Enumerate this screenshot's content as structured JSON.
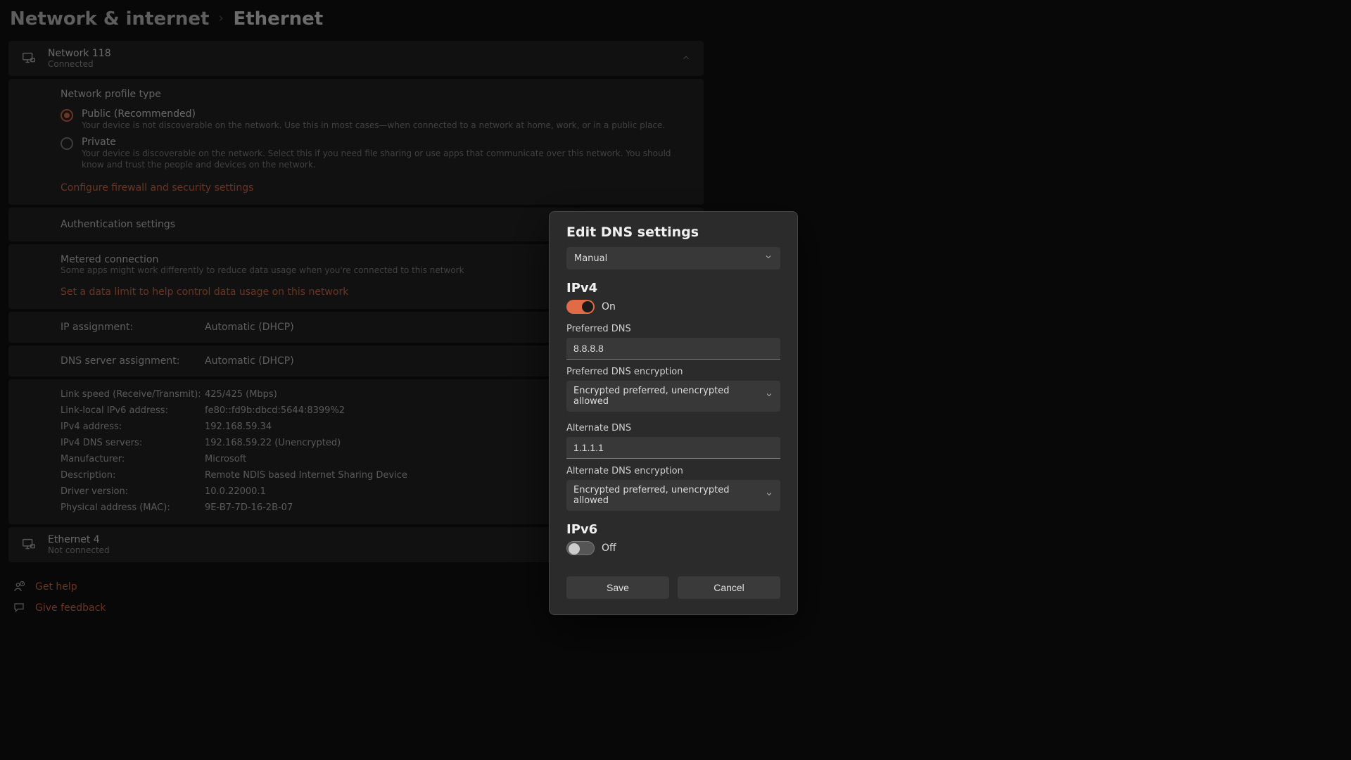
{
  "breadcrumb": {
    "parent": "Network & internet",
    "current": "Ethernet"
  },
  "adapter_primary": {
    "name": "Network 118",
    "status": "Connected"
  },
  "profile": {
    "section_title": "Network profile type",
    "options": [
      {
        "label": "Public (Recommended)",
        "desc": "Your device is not discoverable on the network. Use this in most cases—when connected to a network at home, work, or in a public place.",
        "selected": true
      },
      {
        "label": "Private",
        "desc": "Your device is discoverable on the network. Select this if you need file sharing or use apps that communicate over this network. You should know and trust the people and devices on the network.",
        "selected": false
      }
    ],
    "firewall_link": "Configure firewall and security settings"
  },
  "auth_section_title": "Authentication settings",
  "metered": {
    "title": "Metered connection",
    "desc": "Some apps might work differently to reduce data usage when you're connected to this network",
    "link": "Set a data limit to help control data usage on this network"
  },
  "assignments": {
    "ip_label": "IP assignment:",
    "ip_value": "Automatic (DHCP)",
    "dns_label": "DNS server assignment:",
    "dns_value": "Automatic (DHCP)"
  },
  "info": [
    {
      "label": "Link speed (Receive/Transmit):",
      "value": "425/425 (Mbps)"
    },
    {
      "label": "Link-local IPv6 address:",
      "value": "fe80::fd9b:dbcd:5644:8399%2"
    },
    {
      "label": "IPv4 address:",
      "value": "192.168.59.34"
    },
    {
      "label": "IPv4 DNS servers:",
      "value": "192.168.59.22 (Unencrypted)"
    },
    {
      "label": "Manufacturer:",
      "value": "Microsoft"
    },
    {
      "label": "Description:",
      "value": "Remote NDIS based Internet Sharing Device"
    },
    {
      "label": "Driver version:",
      "value": "10.0.22000.1"
    },
    {
      "label": "Physical address (MAC):",
      "value": "9E-B7-7D-16-2B-07"
    }
  ],
  "adapter_secondary": {
    "name": "Ethernet 4",
    "status": "Not connected"
  },
  "footer": {
    "help": "Get help",
    "feedback": "Give feedback"
  },
  "dialog": {
    "title": "Edit DNS settings",
    "mode_value": "Manual",
    "ipv4": {
      "heading": "IPv4",
      "toggle_label": "On",
      "preferred_label": "Preferred DNS",
      "preferred_value": "8.8.8.8",
      "preferred_enc_label": "Preferred DNS encryption",
      "preferred_enc_value": "Encrypted preferred, unencrypted allowed",
      "alternate_label": "Alternate DNS",
      "alternate_value": "1.1.1.1",
      "alternate_enc_label": "Alternate DNS encryption",
      "alternate_enc_value": "Encrypted preferred, unencrypted allowed"
    },
    "ipv6": {
      "heading": "IPv6",
      "toggle_label": "Off"
    },
    "save_label": "Save",
    "cancel_label": "Cancel"
  }
}
